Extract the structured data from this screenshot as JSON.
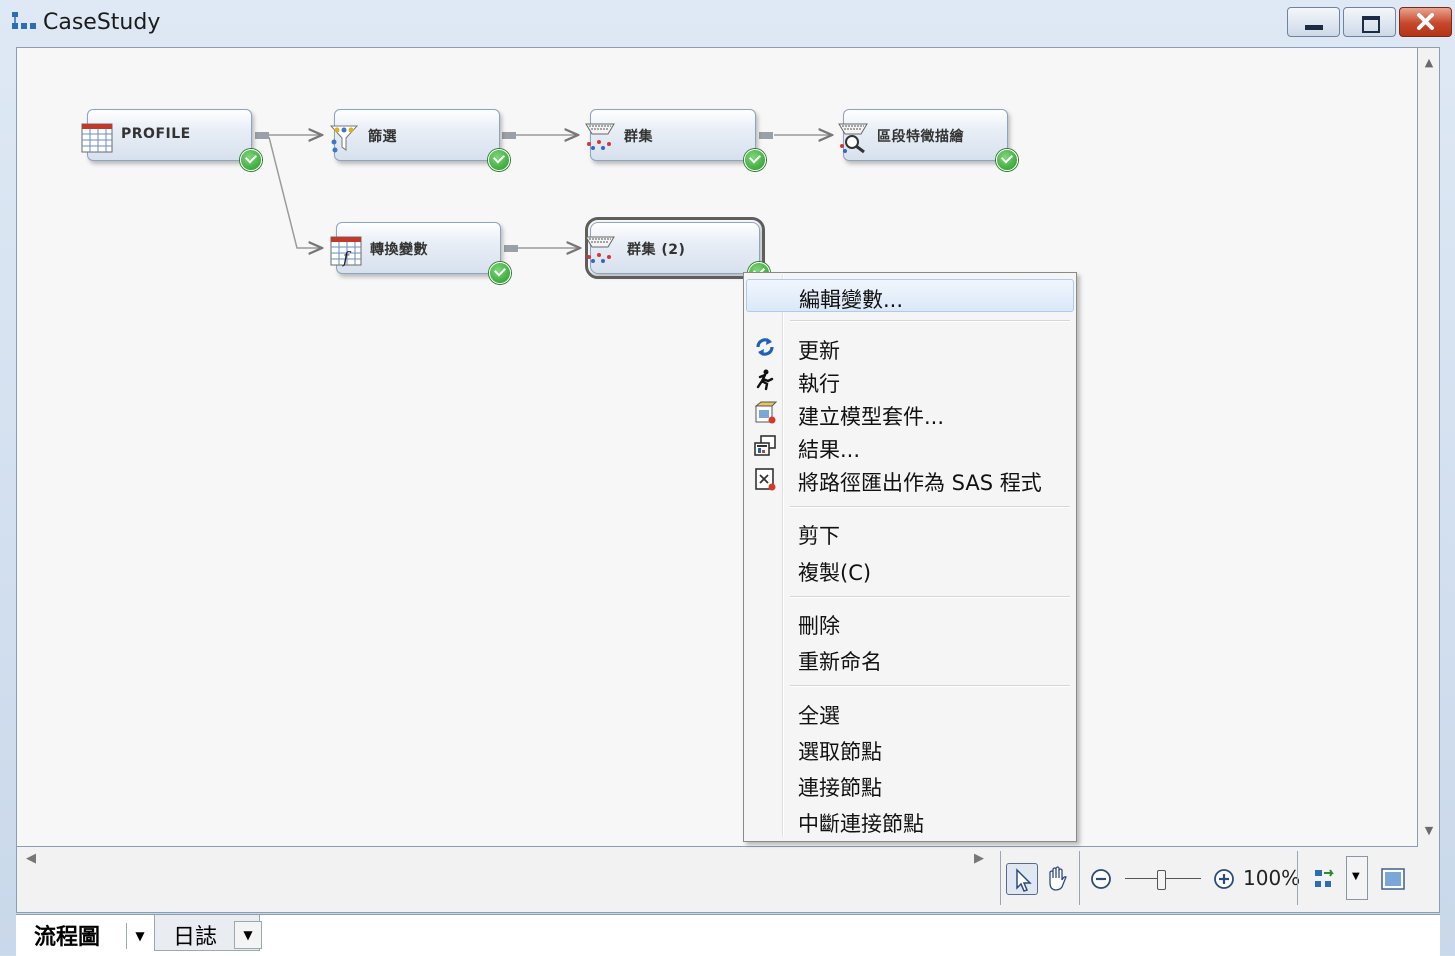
{
  "window": {
    "title": "CaseStudy"
  },
  "nodes": {
    "profile": {
      "label": "PROFILE"
    },
    "filter": {
      "label": "篩選"
    },
    "cluster": {
      "label": "群集"
    },
    "segment_profile": {
      "label": "區段特徵描繪"
    },
    "transform": {
      "label": "轉換變數"
    },
    "cluster2": {
      "label": "群集 (2)"
    }
  },
  "context_menu": {
    "items": [
      {
        "label": "編輯變數...",
        "icon": ""
      },
      {
        "label": "更新",
        "icon": "refresh-icon"
      },
      {
        "label": "執行",
        "icon": "run-icon"
      },
      {
        "label": "建立模型套件...",
        "icon": "model-package-icon"
      },
      {
        "label": "結果...",
        "icon": "results-icon"
      },
      {
        "label": "將路徑匯出作為 SAS 程式",
        "icon": "export-sas-icon"
      },
      {
        "label": "剪下",
        "icon": ""
      },
      {
        "label": "複製(C)",
        "icon": ""
      },
      {
        "label": "刪除",
        "icon": ""
      },
      {
        "label": "重新命名",
        "icon": ""
      },
      {
        "label": "全選",
        "icon": ""
      },
      {
        "label": "選取節點",
        "icon": ""
      },
      {
        "label": "連接節點",
        "icon": ""
      },
      {
        "label": "中斷連接節點",
        "icon": ""
      }
    ]
  },
  "toolbar": {
    "zoom_label": "100%"
  },
  "tabs": [
    {
      "label": "流程圖"
    },
    {
      "label": "日誌"
    }
  ]
}
